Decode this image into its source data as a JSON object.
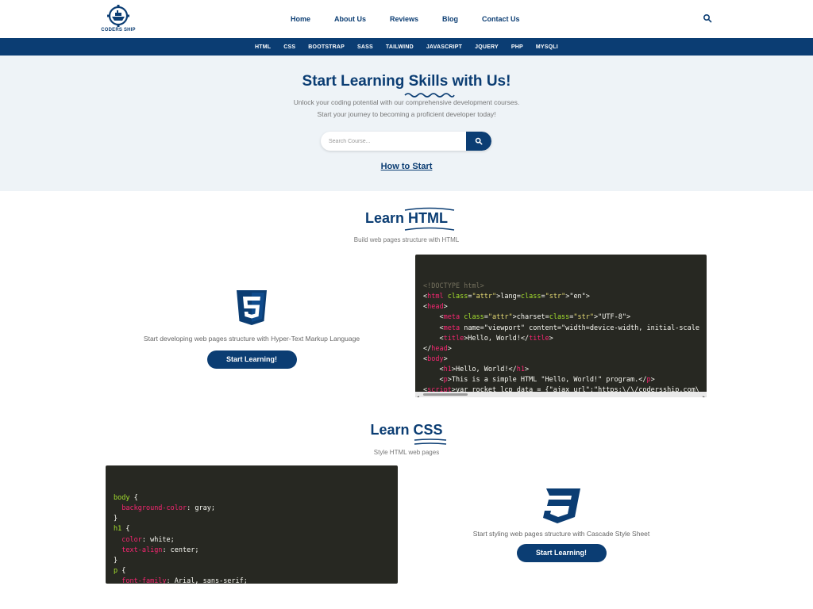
{
  "header": {
    "logo_text": "CODERS SHIP",
    "nav": [
      "Home",
      "About Us",
      "Reviews",
      "Blog",
      "Contact Us"
    ]
  },
  "categories": [
    "HTML",
    "CSS",
    "BOOTSTRAP",
    "SASS",
    "TAILWIND",
    "JAVASCRIPT",
    "JQUERY",
    "PHP",
    "MYSQLI"
  ],
  "hero": {
    "title": "Start Learning Skills with Us!",
    "subtitle_line1": "Unlock your coding potential with our comprehensive development courses.",
    "subtitle_line2": "Start your journey to becoming a proficient developer today!",
    "search_placeholder": "Search Course...",
    "how_link": "How to Start"
  },
  "html_section": {
    "title": "Learn HTML",
    "subtitle": "Build web pages structure with HTML",
    "feature_text": "Start developing web pages structure with Hyper-Text Markup Language",
    "button": "Start Learning!"
  },
  "css_section": {
    "title": "Learn CSS",
    "subtitle": "Style HTML web pages",
    "feature_text": "Start styling  web pages structure with Cascade Style Sheet",
    "button": "Start Learning!"
  },
  "html_code": [
    "<!DOCTYPE html>",
    "<html lang=\"en\">",
    "<head>",
    "    <meta charset=\"UTF-8\">",
    "    <meta name=\"viewport\" content=\"width=device-width, initial-scale",
    "    <title>Hello, World!</title>",
    "</head>",
    "<body>",
    "    <h1>Hello, World!</h1>",
    "    <p>This is a simple HTML \"Hello, World!\" program.</p>",
    "<script>var rocket_lcp_data = {\"ajax_url\":\"https:\\/\\/codersship.com\\",
    "</html>"
  ],
  "css_code": [
    "body {",
    "  background-color: gray;",
    "}",
    "h1 {",
    "  color: white;",
    "  text-align: center;",
    "}",
    "p {",
    "  font-family: Arial, sans-serif;",
    "}"
  ],
  "colors": {
    "brand": "#0b3d73",
    "code_bg": "#272822"
  }
}
